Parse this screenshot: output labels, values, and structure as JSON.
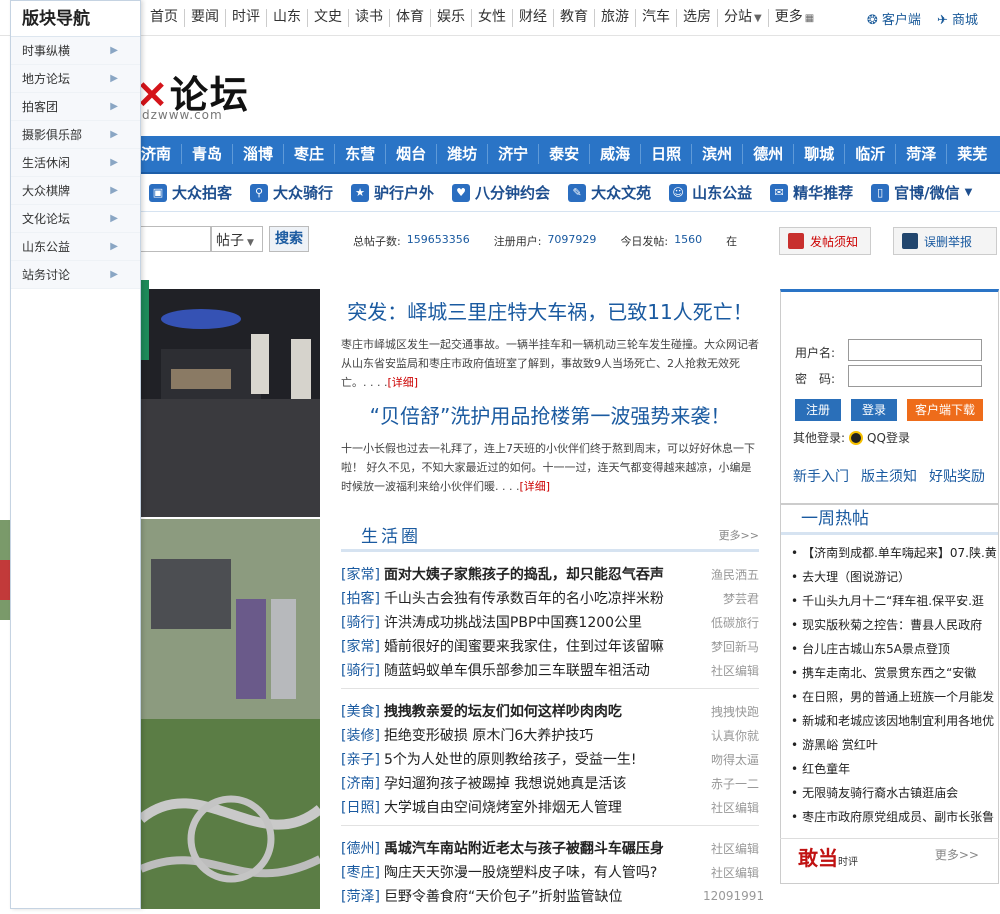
{
  "topbar": {
    "links": [
      "首页",
      "要闻",
      "时评",
      "山东",
      "文史",
      "读书",
      "体育",
      "娱乐",
      "女性",
      "财经",
      "教育",
      "旅游",
      "汽车",
      "选房",
      "分站",
      "更多"
    ],
    "client": "客户端",
    "mall": "商城"
  },
  "logo": {
    "text": "论坛",
    "sub": "dzwww.com"
  },
  "cities": [
    "济南",
    "青岛",
    "淄博",
    "枣庄",
    "东营",
    "烟台",
    "潍坊",
    "济宁",
    "泰安",
    "威海",
    "日照",
    "滨州",
    "德州",
    "聊城",
    "临沂",
    "菏泽",
    "莱芜"
  ],
  "features": [
    {
      "label": "大众拍客",
      "icon": "camera-icon"
    },
    {
      "label": "大众骑行",
      "icon": "bicycle-icon"
    },
    {
      "label": "驴行户外",
      "icon": "star-icon"
    },
    {
      "label": "八分钟约会",
      "icon": "heart-icon"
    },
    {
      "label": "大众文苑",
      "icon": "edit-icon"
    },
    {
      "label": "山东公益",
      "icon": "smile-icon"
    },
    {
      "label": "精华推荐",
      "icon": "chat-icon"
    },
    {
      "label": "官博/微信",
      "icon": "phone-icon"
    }
  ],
  "search": {
    "type": "帖子",
    "button": "搜索"
  },
  "stats": {
    "posts_label": "总帖子数:",
    "posts": "159653356",
    "users_label": "注册用户:",
    "users": "7097929",
    "today_label": "今日发帖:",
    "today": "1560",
    "online_label": "在"
  },
  "notice_btn": "发帖须知",
  "report_btn": "误删举报",
  "headlines": [
    {
      "title": "突发：峄城三里庄特大车祸，已致11人死亡！",
      "body": "枣庄市峄城区发生一起交通事故。一辆半挂车和一辆机动三轮车发生碰撞。大众网记者从山东省安监局和枣庄市政府值班室了解到，事故致9人当场死亡、2人抢救无效死亡。. . . .",
      "more": "[详细]"
    },
    {
      "title": "“贝倍舒”洗护用品抢楼第一波强势来袭！",
      "body": "十一小长假也过去一礼拜了，连上7天班的小伙伴们终于熬到周末，可以好好休息一下啦！ 好久不见，不知大家最近过的如何。十一一过，连天气都变得越来越凉，小编是时候放一波福利来给小伙伴们暖. . . .",
      "more": "[详细]"
    }
  ],
  "circle": {
    "title": "生活圈",
    "more": "更多>>",
    "groups": [
      [
        {
          "tag": "[家常]",
          "text": "面对大姨子家熊孩子的捣乱，却只能忍气吞声",
          "src": "渔民洒五",
          "bold": true
        },
        {
          "tag": "[拍客]",
          "text": "千山头古会独有传承数百年的名小吃凉拌米粉",
          "src": "梦芸君",
          "bold": false
        },
        {
          "tag": "[骑行]",
          "text": "许洪涛成功挑战法国PBP中国赛1200公里",
          "src": "低碳旅行",
          "bold": false
        },
        {
          "tag": "[家常]",
          "text": "婚前很好的闺蜜要来我家住，住到过年该留嘛",
          "src": "梦回新马",
          "bold": false
        },
        {
          "tag": "[骑行]",
          "text": "随蓝蚂蚁单车俱乐部参加三车联盟车祖活动",
          "src": "社区编辑",
          "bold": false
        }
      ],
      [
        {
          "tag": "[美食]",
          "text": "拽拽教亲爱的坛友们如何这样吵肉肉吃",
          "src": "拽拽快跑",
          "bold": true
        },
        {
          "tag": "[装修]",
          "text": "拒绝变形破损 原木门6大养护技巧",
          "src": "认真你就",
          "bold": false
        },
        {
          "tag": "[亲子]",
          "text": "5个为人处世的原则教给孩子，受益一生!",
          "src": "吻得太逼",
          "bold": false
        },
        {
          "tag": "[济南]",
          "text": "孕妇遛狗孩子被踢掉 我想说她真是活该",
          "src": "赤子一二",
          "bold": false
        },
        {
          "tag": "[日照]",
          "text": "大学城自由空间烧烤室外排烟无人管理",
          "src": "社区编辑",
          "bold": false
        }
      ],
      [
        {
          "tag": "[德州]",
          "text": "禹城汽车南站附近老太与孩子被翻斗车碾压身",
          "src": "社区编辑",
          "bold": true
        },
        {
          "tag": "[枣庄]",
          "text": "陶庄天天弥漫一股烧塑料皮子味，有人管吗?",
          "src": "社区编辑",
          "bold": false
        },
        {
          "tag": "[菏泽]",
          "text": "巨野令善食府“天价包子”折射监管缺位",
          "src": "12091991",
          "bold": false
        }
      ]
    ]
  },
  "login": {
    "user_label": "用户名:",
    "pass_label": "密　码:",
    "register": "注册",
    "login": "登录",
    "download": "客户端下载",
    "other": "其他登录:",
    "qq": "QQ登录",
    "links": [
      "新手入门",
      "版主须知",
      "好贴奖励"
    ]
  },
  "hot": {
    "title": "一周热帖",
    "items": [
      "【济南到成都.单车嗨起来】07.陕.黄",
      "去大理（图说游记）",
      "千山头九月十二“拜车祖.保平安.逛",
      "现实版秋菊之控告：曹县人民政府",
      "台儿庄古城山东5A景点登顶",
      "携车走南北、赏景贯东西之“安徽",
      "在日照，男的普通上班族一个月能发",
      "新城和老城应该因地制宜利用各地优",
      "游黑峪 赏红叶",
      "红色童年",
      "无限骑友骑行裔水古镇逛庙会",
      "枣庄市政府原党组成员、副市长张鲁"
    ],
    "more": "更多>>"
  },
  "foot_logo": {
    "main": "敢当",
    "sub": "时评"
  },
  "sidenav": {
    "title": "版块导航",
    "items": [
      "时事纵横",
      "地方论坛",
      "拍客团",
      "摄影俱乐部",
      "生活休闲",
      "大众棋牌",
      "文化论坛",
      "山东公益",
      "站务讨论"
    ]
  },
  "colors": {
    "brand": "#2a74c6",
    "link": "#1a5aa0",
    "accent": "#d4141a",
    "orange": "#ee6c1a"
  }
}
